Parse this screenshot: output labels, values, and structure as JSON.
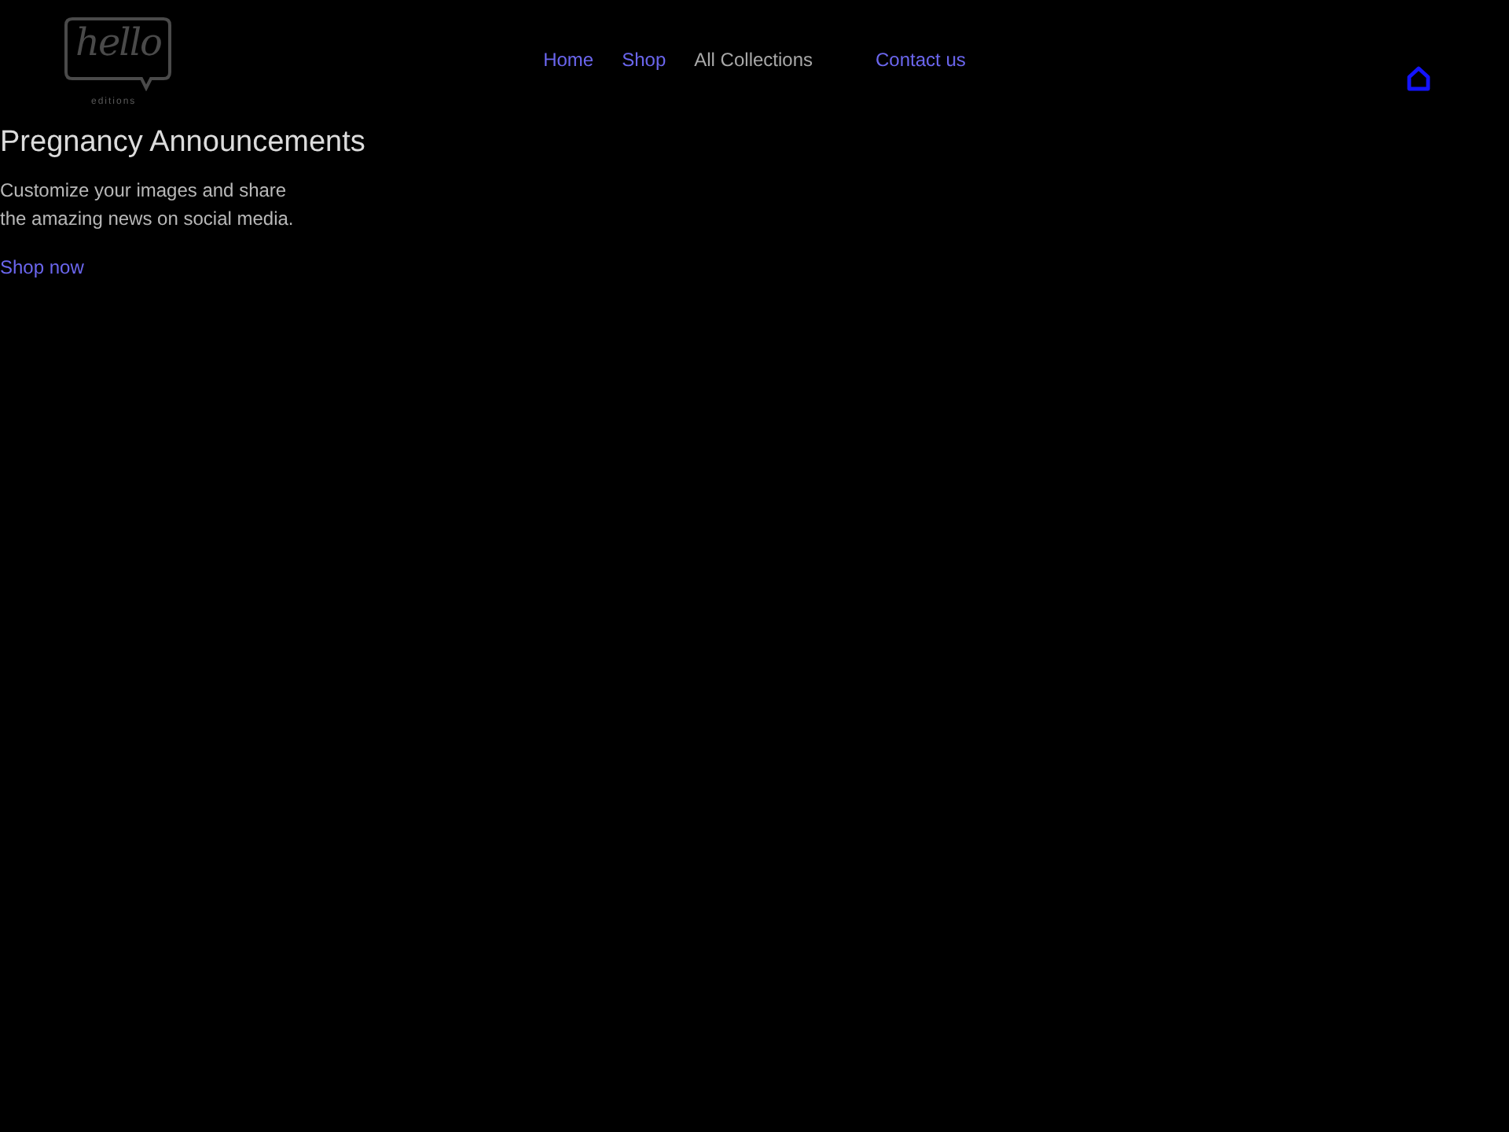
{
  "header": {
    "logo": {
      "wordmark": "hello",
      "tagline": "editions"
    },
    "nav": [
      {
        "label": "Home",
        "selected": false
      },
      {
        "label": "Shop",
        "selected": false
      },
      {
        "label": "All Collections",
        "selected": true
      },
      {
        "label": "Contact us",
        "selected": false
      }
    ]
  },
  "hero": {
    "title": "Pregnancy Announcements",
    "text": "Customize your images and share the amazing news on social media.",
    "link": "Shop now"
  }
}
